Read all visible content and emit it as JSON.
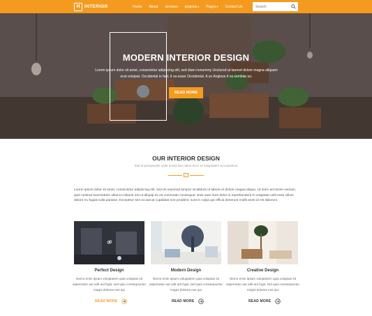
{
  "brand": {
    "logo_letter": "H",
    "name": "INTERIOR"
  },
  "nav": {
    "items": [
      {
        "label": "Home",
        "caret": ""
      },
      {
        "label": "About",
        "caret": ""
      },
      {
        "label": "services",
        "caret": ""
      },
      {
        "label": "projects",
        "caret": "▾"
      },
      {
        "label": "Pages",
        "caret": "▾"
      },
      {
        "label": "Contact Us",
        "caret": ""
      }
    ]
  },
  "search": {
    "placeholder": "Search",
    "icon": "search-icon"
  },
  "hero": {
    "title": "MODERN INTERIOR DESIGN",
    "text": "Lorem ipsum dolor sit amet, consectetur adipiscing elit, sed diam nonummy Unclured ut laoreet dolore magna aliquam erat volutpat. Occidental in fact, it va esser Occidental. A un Angleso it va semblar un.",
    "button": "READ MORE"
  },
  "section": {
    "title": "OUR INTERIOR DESIGN",
    "subtitle": "Sed ut perspiciatis unde omnis iste natus error sit voluptatem accusantium",
    "paragraph": "Lorem ipsum dolor sit amet, consectetur adipiscing elit, sed do eiusmod tempor incididunt ut labore et dolore magna aliqua. Ut enim ad minim veniam, quis nostrud exercitation ullamco laboris nisi ut aliquip ex ea commodo consequat. Duis aute irure dolor in reprehenderit in voluptate velit esse cillum dolore eu fugiat nulla pariatur. Excepteur sint occaecat cupidatat non proident, sunt in culpa qui officia deserunt mollit anim id est laborum."
  },
  "cards": [
    {
      "title": "Perfect Design",
      "text": "Nemo enim ipsam voluptatem quia voluptas sit aspernatur aut odit aut fugit, sed quia consequuntur magni dolores eos qui",
      "link": "READ MORE"
    },
    {
      "title": "Modern Design",
      "text": "Nemo enim ipsam voluptatem quia voluptas sit aspernatur aut odit aut fugit, sed quia consequuntur magni dolores eos qui",
      "link": "READ MORE"
    },
    {
      "title": "Creative Design",
      "text": "Nemo enim ipsam voluptatem quia voluptas sit aspernatur aut odit aut fugit, sed quia consequuntur magni dolores eos qui",
      "link": "READ MORE"
    }
  ],
  "colors": {
    "accent": "#f49b1f",
    "text": "#333333",
    "muted": "#999999"
  }
}
